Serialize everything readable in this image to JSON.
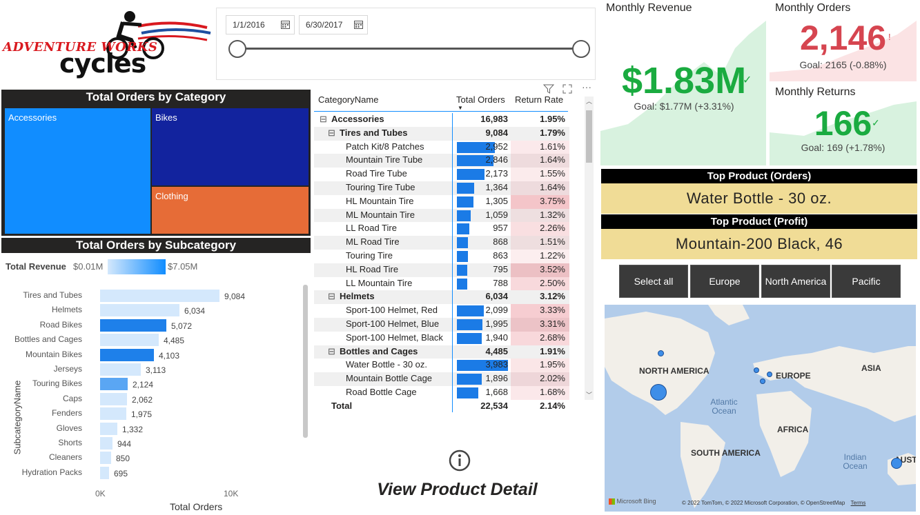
{
  "logo": {
    "line1": "ADVENTURE WORKS",
    "line2": "cycles"
  },
  "date_slicer": {
    "start": "1/1/2016",
    "end": "6/30/2017"
  },
  "treemap": {
    "title": "Total Orders by Category",
    "cells": [
      {
        "label": "Accessories",
        "color": "#118dff"
      },
      {
        "label": "Bikes",
        "color": "#12239e"
      },
      {
        "label": "Clothing",
        "color": "#e66c37"
      }
    ]
  },
  "subcategory_chart": {
    "title": "Total Orders by Subcategory",
    "legend_title": "Total Revenue",
    "legend_min": "$0.01M",
    "legend_max": "$7.05M",
    "y_axis_label": "SubcategoryName",
    "x_axis_label": "Total Orders",
    "x_ticks": [
      "0K",
      "10K"
    ]
  },
  "chart_data": {
    "type": "bar",
    "orientation": "horizontal",
    "categories": [
      "Tires and Tubes",
      "Helmets",
      "Road Bikes",
      "Bottles and Cages",
      "Mountain Bikes",
      "Jerseys",
      "Touring Bikes",
      "Caps",
      "Fenders",
      "Gloves",
      "Shorts",
      "Cleaners",
      "Hydration Packs"
    ],
    "values": [
      9084,
      6034,
      5072,
      4485,
      4103,
      3113,
      2124,
      2062,
      1975,
      1332,
      944,
      850,
      695
    ],
    "value_labels": [
      "9,084",
      "6,034",
      "5,072",
      "4,485",
      "4,103",
      "3,113",
      "2,124",
      "2,062",
      "1,975",
      "1,332",
      "944",
      "850",
      "695"
    ],
    "colors": [
      "#d4e8fc",
      "#d4e8fc",
      "#1e80ea",
      "#d4e8fc",
      "#1e80ea",
      "#d4e8fc",
      "#5aa6f3",
      "#d4e8fc",
      "#d4e8fc",
      "#d4e8fc",
      "#d4e8fc",
      "#d4e8fc",
      "#d4e8fc"
    ],
    "xlim": [
      0,
      10000
    ],
    "xlabel": "Total Orders",
    "ylabel": "SubcategoryName"
  },
  "matrix": {
    "headers": [
      "CategoryName",
      "Total Orders",
      "Return Rate"
    ],
    "rows": [
      {
        "level": 0,
        "toggle": "⊟",
        "name": "Accessories",
        "orders": "16,983",
        "rate": "1.95%",
        "bar": 0,
        "rr": 0
      },
      {
        "level": 1,
        "toggle": "⊟",
        "name": "Tires and Tubes",
        "orders": "9,084",
        "rate": "1.79%",
        "bar": 0,
        "rr": 0
      },
      {
        "level": 2,
        "toggle": "",
        "name": "Patch Kit/8 Patches",
        "orders": "2,952",
        "rate": "1.61%",
        "bar": 0.74,
        "rr": 0.12
      },
      {
        "level": 2,
        "toggle": "",
        "name": "Mountain Tire Tube",
        "orders": "2,846",
        "rate": "1.64%",
        "bar": 0.71,
        "rr": 0.13
      },
      {
        "level": 2,
        "toggle": "",
        "name": "Road Tire Tube",
        "orders": "2,173",
        "rate": "1.55%",
        "bar": 0.54,
        "rr": 0.1
      },
      {
        "level": 2,
        "toggle": "",
        "name": "Touring Tire Tube",
        "orders": "1,364",
        "rate": "1.64%",
        "bar": 0.34,
        "rr": 0.13
      },
      {
        "level": 2,
        "toggle": "",
        "name": "HL Mountain Tire",
        "orders": "1,305",
        "rate": "3.75%",
        "bar": 0.33,
        "rr": 0.9
      },
      {
        "level": 2,
        "toggle": "",
        "name": "ML Mountain Tire",
        "orders": "1,059",
        "rate": "1.32%",
        "bar": 0.27,
        "rr": 0.05
      },
      {
        "level": 2,
        "toggle": "",
        "name": "LL Road Tire",
        "orders": "957",
        "rate": "2.26%",
        "bar": 0.24,
        "rr": 0.35
      },
      {
        "level": 2,
        "toggle": "",
        "name": "ML Road Tire",
        "orders": "868",
        "rate": "1.51%",
        "bar": 0.22,
        "rr": 0.1
      },
      {
        "level": 2,
        "toggle": "",
        "name": "Touring Tire",
        "orders": "863",
        "rate": "1.22%",
        "bar": 0.22,
        "rr": 0.03
      },
      {
        "level": 2,
        "toggle": "",
        "name": "HL Road Tire",
        "orders": "795",
        "rate": "3.52%",
        "bar": 0.2,
        "rr": 0.8
      },
      {
        "level": 2,
        "toggle": "",
        "name": "LL Mountain Tire",
        "orders": "788",
        "rate": "2.50%",
        "bar": 0.2,
        "rr": 0.45
      },
      {
        "level": 1,
        "toggle": "⊟",
        "name": "Helmets",
        "orders": "6,034",
        "rate": "3.12%",
        "bar": 0,
        "rr": 0
      },
      {
        "level": 2,
        "toggle": "",
        "name": "Sport-100 Helmet, Red",
        "orders": "2,099",
        "rate": "3.33%",
        "bar": 0.53,
        "rr": 0.72
      },
      {
        "level": 2,
        "toggle": "",
        "name": "Sport-100 Helmet, Blue",
        "orders": "1,995",
        "rate": "3.31%",
        "bar": 0.5,
        "rr": 0.71
      },
      {
        "level": 2,
        "toggle": "",
        "name": "Sport-100 Helmet, Black",
        "orders": "1,940",
        "rate": "2.68%",
        "bar": 0.49,
        "rr": 0.5
      },
      {
        "level": 1,
        "toggle": "⊟",
        "name": "Bottles and Cages",
        "orders": "4,485",
        "rate": "1.91%",
        "bar": 0,
        "rr": 0
      },
      {
        "level": 2,
        "toggle": "",
        "name": "Water Bottle - 30 oz.",
        "orders": "3,983",
        "rate": "1.95%",
        "bar": 1.0,
        "rr": 0.2
      },
      {
        "level": 2,
        "toggle": "",
        "name": "Mountain Bottle Cage",
        "orders": "1,896",
        "rate": "2.02%",
        "bar": 0.48,
        "rr": 0.25
      },
      {
        "level": 2,
        "toggle": "",
        "name": "Road Bottle Cage",
        "orders": "1,668",
        "rate": "1.68%",
        "bar": 0.42,
        "rr": 0.13
      }
    ],
    "total": {
      "name": "Total",
      "orders": "22,534",
      "rate": "2.14%"
    }
  },
  "view_detail": {
    "label": "View Product Detail"
  },
  "kpis": {
    "revenue": {
      "title": "Monthly Revenue",
      "value": "$1.83M",
      "goal": "Goal: $1.77M (+3.31%)",
      "color": "#1aab40"
    },
    "orders": {
      "title": "Monthly Orders",
      "value": "2,146",
      "goal": "Goal: 2165 (-0.88%)",
      "color": "#d64550"
    },
    "returns": {
      "title": "Monthly Returns",
      "value": "166",
      "goal": "Goal: 169 (+1.78%)",
      "color": "#1aab40"
    }
  },
  "top_product": {
    "orders_header": "Top Product (Orders)",
    "orders_value": "Water Bottle - 30 oz.",
    "profit_header": "Top Product (Profit)",
    "profit_value": "Mountain-200 Black, 46"
  },
  "region_buttons": [
    "Select all",
    "Europe",
    "North America",
    "Pacific"
  ],
  "map": {
    "labels": {
      "na": "NORTH AMERICA",
      "eu": "EUROPE",
      "asia": "ASIA",
      "africa": "AFRICA",
      "sa": "SOUTH AMERICA",
      "aus": "AUSTI",
      "atlantic": "Atlantic Ocean",
      "indian": "Indian Ocean"
    },
    "brand": "Microsoft Bing",
    "copyright": "© 2022 TomTom, © 2022 Microsoft Corporation, © OpenStreetMap",
    "terms": "Terms"
  }
}
